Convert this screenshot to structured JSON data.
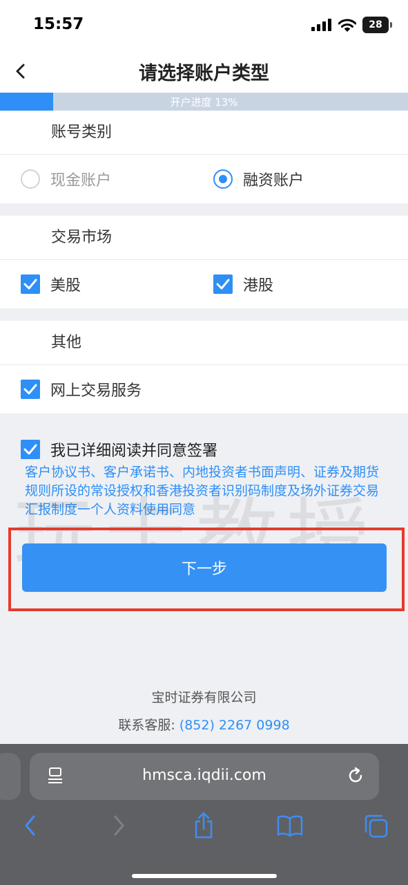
{
  "status_bar": {
    "time": "15:57",
    "battery": "28"
  },
  "header": {
    "title": "请选择账户类型"
  },
  "progress": {
    "label": "开户进度 13%",
    "value": 0.13
  },
  "account_type": {
    "title": "账号类别",
    "options": [
      {
        "label": "现金账户",
        "selected": false
      },
      {
        "label": "融资账户",
        "selected": true
      }
    ]
  },
  "market": {
    "title": "交易市场",
    "options": [
      {
        "label": "美股",
        "checked": true
      },
      {
        "label": "港股",
        "checked": true
      }
    ]
  },
  "other": {
    "title": "其他",
    "options": [
      {
        "label": "网上交易服务",
        "checked": true
      }
    ]
  },
  "agreement": {
    "label": "我已详细阅读并同意签署",
    "checked": true,
    "documents": "客户协议书、客户承诺书、内地投资者书面声明、证券及期货规则所设的常设授权和香港投资者识别码制度及场外证券交易汇报制度一个人资料使用同意"
  },
  "watermark": "玩卡教授",
  "next_button": "下一步",
  "footer": {
    "company": "宝时证券有限公司",
    "hotline_label": "联系客服:",
    "hotline_number": "(852) 2267 0998"
  },
  "browser": {
    "url": "hmsca.iqdii.com"
  },
  "colors": {
    "accent": "#2e8ff6",
    "highlight": "#e53a2c"
  }
}
